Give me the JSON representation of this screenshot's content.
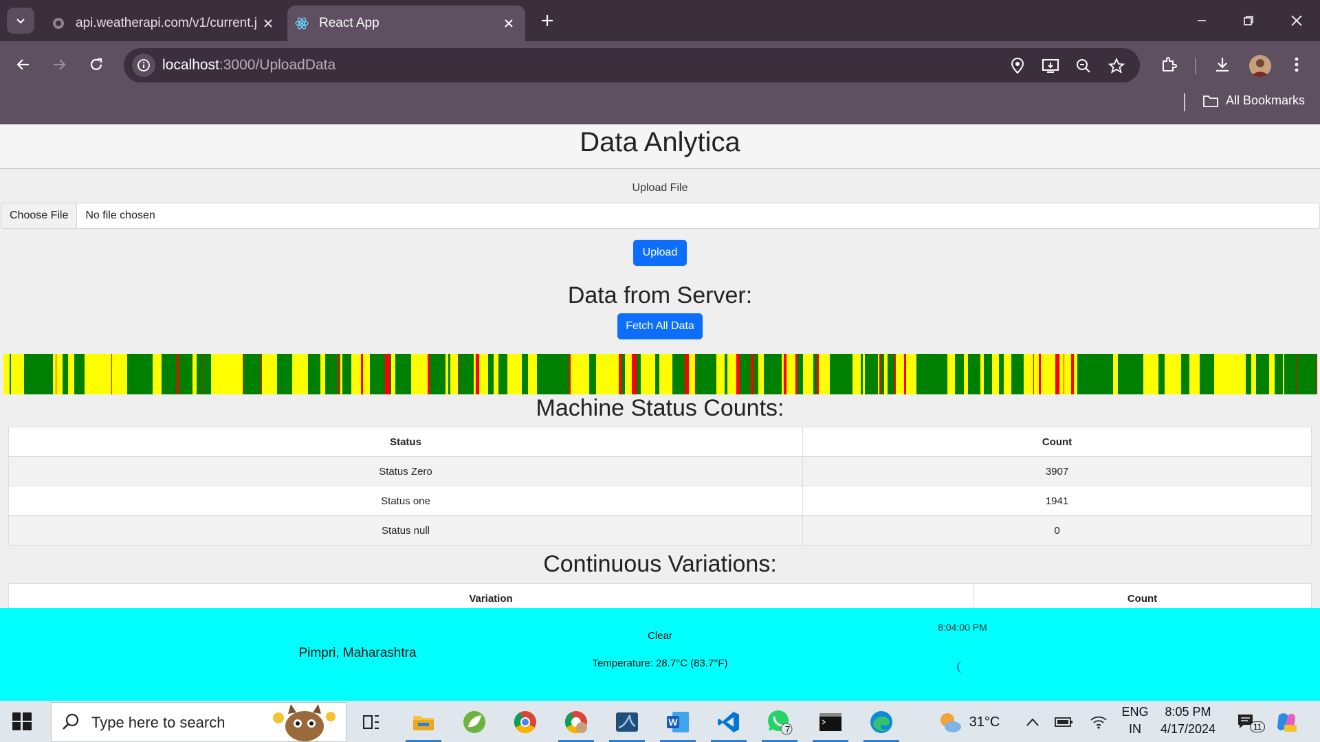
{
  "browser": {
    "tabs": [
      {
        "title": "api.weatherapi.com/v1/current.j",
        "active": false
      },
      {
        "title": "React App",
        "active": true
      }
    ],
    "url_host": "localhost",
    "url_path": ":3000/UploadData",
    "bookmarks_label": "All Bookmarks"
  },
  "page": {
    "title": "Data Anlytica",
    "upload_label": "Upload File",
    "file_button": "Choose File",
    "file_status": "No file chosen",
    "upload_button": "Upload",
    "server_heading": "Data from Server:",
    "fetch_button": "Fetch All Data",
    "strip_colors": {
      "zero": "#ffff00",
      "one": "#008000",
      "null": "#ff0000"
    },
    "status_heading": "Machine Status Counts:",
    "status_table": {
      "headers": [
        "Status",
        "Count"
      ],
      "rows": [
        [
          "Status Zero",
          "3907"
        ],
        [
          "Status one",
          "1941"
        ],
        [
          "Status null",
          "0"
        ]
      ]
    },
    "variations_heading": "Continuous Variations:",
    "variations_table": {
      "headers": [
        "Variation",
        "Count"
      ]
    }
  },
  "weather": {
    "location": "Pimpri, Maharashtra",
    "condition": "Clear",
    "temperature": "Temperature: 28.7°C (83.7°F)",
    "time": "8:04:00 PM",
    "icon": "moon-icon",
    "background": "#00ffff"
  },
  "taskbar": {
    "search_placeholder": "Type here to search",
    "weather_temp": "31°C",
    "lang_top": "ENG",
    "lang_bottom": "IN",
    "time": "8:05 PM",
    "date": "4/17/2024",
    "whatsapp_badge": "7",
    "notifications_badge": "11"
  }
}
